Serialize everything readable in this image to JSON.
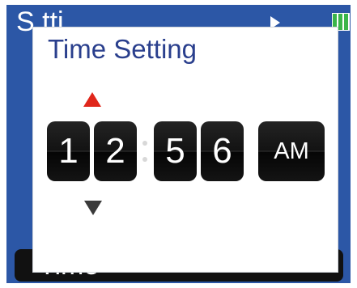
{
  "background_screen": {
    "title_visible": "S tti",
    "bottom_item_label": "Time"
  },
  "dialog": {
    "title": "Time Setting",
    "time": {
      "hour_digit_1": "1",
      "hour_digit_2": "2",
      "minute_digit_1": "5",
      "minute_digit_2": "6",
      "meridiem": "AM"
    }
  },
  "colors": {
    "screen_background": "#2c57a6",
    "dialog_title": "#2a3f8d",
    "up_arrow": "#e0261b",
    "down_arrow": "#3a3a3a",
    "battery": "#3ab54a"
  },
  "icons": [
    "play-icon",
    "battery-icon",
    "up-arrow-icon",
    "down-arrow-icon",
    "chevron-right-icon"
  ]
}
